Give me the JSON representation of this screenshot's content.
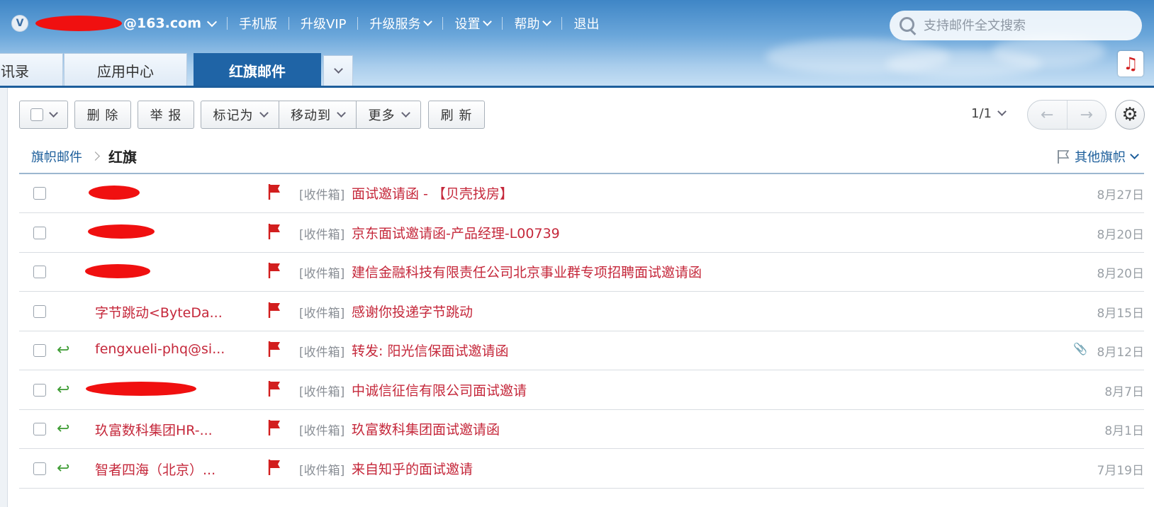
{
  "header": {
    "account_suffix": "@163.com",
    "badge": "V",
    "nav": [
      "手机版",
      "升级VIP",
      "升级服务",
      "设置",
      "帮助",
      "退出"
    ],
    "search_placeholder": "支持邮件全文搜索"
  },
  "tabs": [
    {
      "label": "讯录",
      "active": false
    },
    {
      "label": "应用中心",
      "active": false
    },
    {
      "label": "红旗邮件",
      "active": true
    }
  ],
  "toolbar": {
    "delete": "删 除",
    "report": "举 报",
    "mark_as": "标记为",
    "move_to": "移动到",
    "more": "更多",
    "refresh": "刷 新",
    "page": "1/1"
  },
  "breadcrumb": {
    "parent": "旗帜邮件",
    "current": "红旗",
    "other_flags": "其他旗帜"
  },
  "colors": {
    "header_blue": "#3f86c6",
    "active_tab": "#1f64a6",
    "flag_red": "#d21e1e",
    "subject_red": "#c5283b",
    "reply_green": "#3e9c34"
  },
  "emails": [
    {
      "sender": "",
      "redacted": true,
      "replied": false,
      "folder": "[收件箱]",
      "subject": "面试邀请函 - 【贝壳找房】",
      "date": "8月27日",
      "attachment": false
    },
    {
      "sender": "",
      "redacted": true,
      "replied": false,
      "folder": "[收件箱]",
      "subject": "京东面试邀请函-产品经理-L00739",
      "date": "8月20日",
      "attachment": false
    },
    {
      "sender": "",
      "redacted": true,
      "replied": false,
      "folder": "[收件箱]",
      "subject": "建信金融科技有限责任公司北京事业群专项招聘面试邀请函",
      "date": "8月20日",
      "attachment": false
    },
    {
      "sender": "字节跳动<ByteDa...",
      "redacted": false,
      "replied": false,
      "folder": "[收件箱]",
      "subject": "感谢你投递字节跳动",
      "date": "8月15日",
      "attachment": false
    },
    {
      "sender": "fengxueli-phq@si...",
      "redacted": false,
      "replied": true,
      "folder": "[收件箱]",
      "subject": "转发: 阳光信保面试邀请函",
      "date": "8月12日",
      "attachment": true
    },
    {
      "sender": "",
      "redacted": true,
      "replied": true,
      "folder": "[收件箱]",
      "subject": "中诚信征信有限公司面试邀请",
      "date": "8月7日",
      "attachment": false
    },
    {
      "sender": "玖富数科集团HR-...",
      "redacted": false,
      "replied": true,
      "folder": "[收件箱]",
      "subject": "玖富数科集团面试邀请函",
      "date": "8月1日",
      "attachment": false
    },
    {
      "sender": "智者四海（北京）...",
      "redacted": false,
      "replied": true,
      "folder": "[收件箱]",
      "subject": "来自知乎的面试邀请",
      "date": "7月19日",
      "attachment": false
    }
  ]
}
